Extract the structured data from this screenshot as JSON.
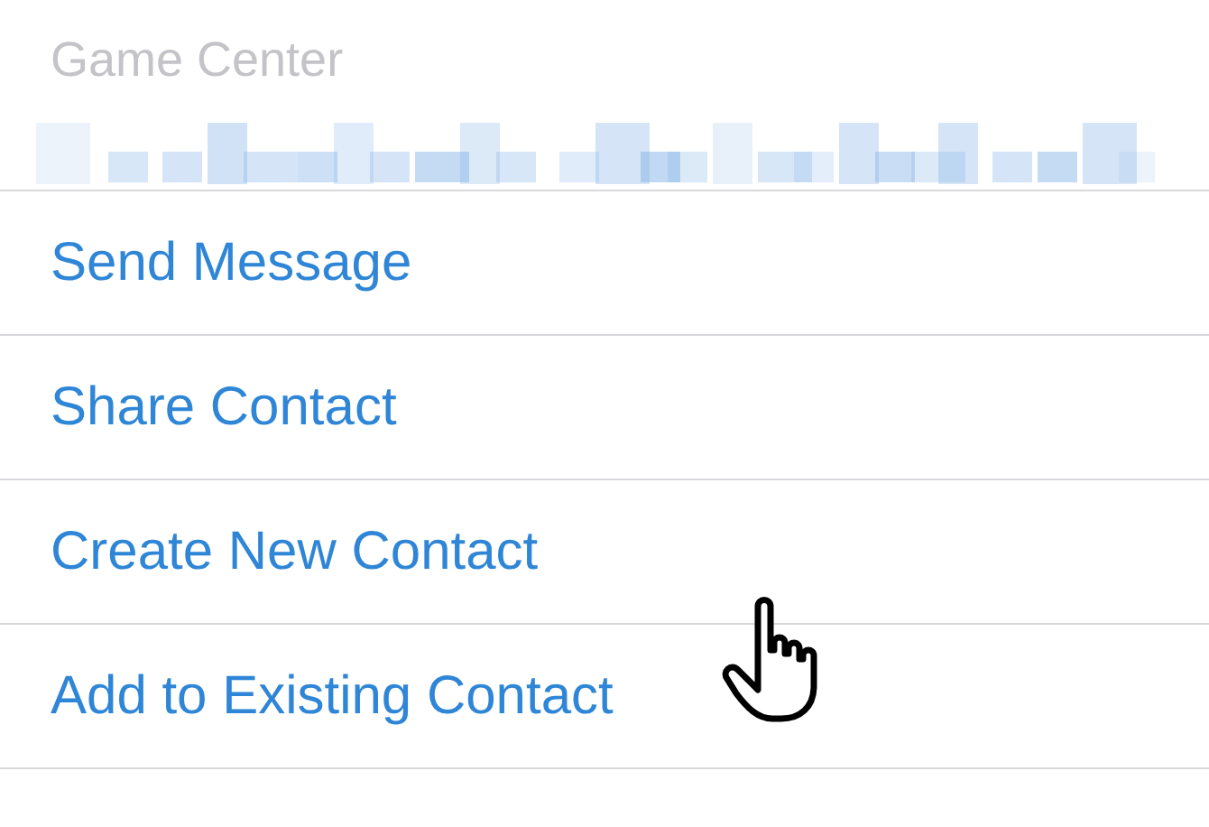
{
  "section": {
    "title": "Game Center"
  },
  "actions": [
    {
      "label": "Send Message"
    },
    {
      "label": "Share Contact"
    },
    {
      "label": "Create New Contact"
    },
    {
      "label": "Add to Existing Contact"
    }
  ]
}
